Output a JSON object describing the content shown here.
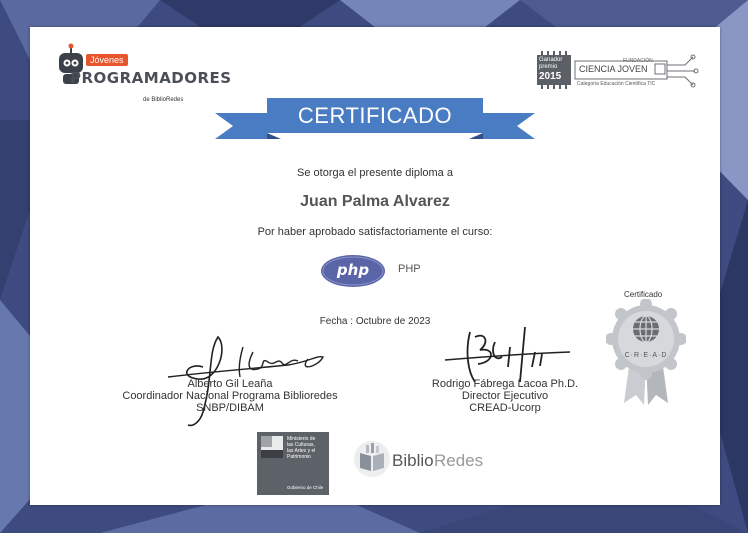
{
  "header": {
    "brand_small": "Jóvenes",
    "brand_big": "PROGRAMADORES",
    "brand_sub": "de BiblioRedes",
    "award_line1": "Ganador",
    "award_line2": "premio",
    "award_year": "2015",
    "award_name": "CIENCIA JOVEN",
    "award_fundacion": "FUNDACIÓN",
    "award_caption": "Categoría Educación Científica TIC"
  },
  "certificate": {
    "title": "CERTIFICADO",
    "grant_text": "Se otorga el presente diploma a",
    "recipient": "Juan Palma Alvarez",
    "reason": "Por haber aprobado satisfactoriamente el curso:",
    "course_logo": "php",
    "course_name": "PHP",
    "date": "Fecha : Octubre de 2023",
    "certified_label": "Certificado",
    "seal_text": "C·R·E·A·D"
  },
  "signatories": [
    {
      "name": "Alberto Gil Leaña",
      "role": "Coordinador Nacional Programa Biblioredes",
      "org": "SNBP/DIBAM"
    },
    {
      "name": "Rodrigo Fábrega Lacoa Ph.D.",
      "role": "Director Ejecutivo",
      "org": "CREAD-Ucorp"
    }
  ],
  "footer": {
    "ministerio_line1": "Ministerio de",
    "ministerio_line2": "las Culturas,",
    "ministerio_line3": "las Artes y el",
    "ministerio_line4": "Patrimonio",
    "ministerio_gov": "Gobierno de Chile",
    "biblio_a": "Biblio",
    "biblio_b": "Redes"
  },
  "colors": {
    "ribbon": "#4a7cc4",
    "ribbon_dark": "#3a64a8",
    "php": "#5a65a8",
    "recipient": "#555555"
  }
}
